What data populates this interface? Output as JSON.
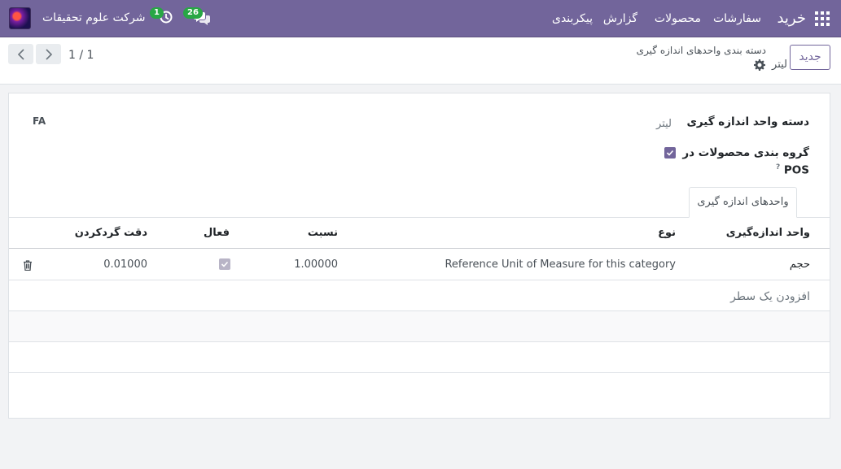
{
  "navbar": {
    "app_name": "خرید",
    "menu": [
      "سفارشات",
      "محصولات",
      "گزارش",
      "پیکربندی"
    ],
    "company": "شرکت علوم تحقیقات",
    "activity_count": "1",
    "messages_count": "26",
    "colors": {
      "primary": "#72659b",
      "badge": "#28a745"
    },
    "icons": [
      "apps-grid-icon",
      "clock-icon",
      "chat-icon"
    ]
  },
  "control_panel": {
    "new_button": "جدید",
    "breadcrumb_parent": "دسته بندی واحدهای اندازه گیری",
    "breadcrumb_current": "لیتر",
    "pager_value": "1 / 1"
  },
  "form": {
    "language_tag": "FA",
    "category_label": "دسته واحد اندازه گیری",
    "category_value": "لیتر",
    "pos_group_label_line1": "گروه بندی محصولات در",
    "pos_group_label_line2": "POS",
    "pos_group_help": "?",
    "pos_group_checked": true,
    "tab_label": "واحدهای اندازه گیری"
  },
  "table": {
    "columns": [
      "واحد اندازه‌گیری",
      "نوع",
      "نسبت",
      "فعال",
      "دقت گردکردن"
    ],
    "rows": [
      {
        "unit": "حجم",
        "type": "Reference Unit of Measure for this category",
        "ratio": "1.00000",
        "active": true,
        "rounding": "0.01000"
      }
    ],
    "add_line": "افزودن یک سطر"
  }
}
